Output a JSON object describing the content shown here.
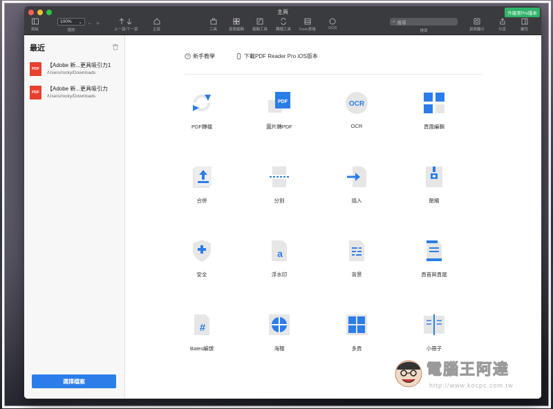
{
  "window": {
    "title": "主頁",
    "pro_badge": "升級至Pro版本"
  },
  "toolbar": {
    "panel_label": "面板",
    "zoom_value": "100%",
    "zoom_label": "縮放",
    "prev_next_label": "上一頁/下一頁",
    "home_label": "主頁",
    "tools_label": "工具",
    "page_edit_label": "頁面編輯",
    "edit_tools_label": "編輯工具",
    "convert_tools_label": "轉檔工具",
    "form_label": "Form表格",
    "ocr_label": "OCR",
    "search_placeholder": "搜尋",
    "search_label": "搜尋",
    "page_display_label": "頁面顯示",
    "share_label": "分享",
    "properties_label": "屬性"
  },
  "sidebar": {
    "title": "最近",
    "recent": [
      {
        "name": "【Adobe 新...更具吸引力1",
        "path": "/Users/rocky/Downloads"
      },
      {
        "name": "【Adobe 新...更具吸引力",
        "path": "/Users/rocky/Downloads"
      }
    ],
    "thumb_label": "PDF",
    "choose_button": "選擇檔案"
  },
  "main": {
    "tutorial_link": "新手教學",
    "download_link": "下載PDF Reader Pro iOS版本",
    "tools": [
      {
        "label": "PDF轉檔",
        "icon": "pdf-convert-icon"
      },
      {
        "label": "圖片轉PDF",
        "icon": "image-to-pdf-icon"
      },
      {
        "label": "OCR",
        "icon": "ocr-icon"
      },
      {
        "label": "頁面編輯",
        "icon": "page-edit-icon"
      },
      {
        "label": "合併",
        "icon": "merge-icon"
      },
      {
        "label": "分割",
        "icon": "split-icon"
      },
      {
        "label": "插入",
        "icon": "insert-icon"
      },
      {
        "label": "壓縮",
        "icon": "compress-icon"
      },
      {
        "label": "安全",
        "icon": "security-icon"
      },
      {
        "label": "浮水印",
        "icon": "watermark-icon"
      },
      {
        "label": "背景",
        "icon": "background-icon"
      },
      {
        "label": "頁首與頁尾",
        "icon": "header-footer-icon"
      },
      {
        "label": "Bates編號",
        "icon": "bates-icon"
      },
      {
        "label": "海報",
        "icon": "poster-icon"
      },
      {
        "label": "多頁",
        "icon": "multipage-icon"
      },
      {
        "label": "小冊子",
        "icon": "booklet-icon"
      }
    ],
    "icon_text": {
      "pdf": "PDF",
      "ocr": "OCR",
      "a": "a",
      "hash": "#"
    }
  },
  "watermark": {
    "title": "電腦王阿達",
    "url": "http://www.kocpc.com.tw"
  },
  "colors": {
    "accent": "#2b7de9",
    "pdf_red": "#e8402d",
    "pro_green": "#2fb36a",
    "toolbar": "#3a3b3f"
  }
}
